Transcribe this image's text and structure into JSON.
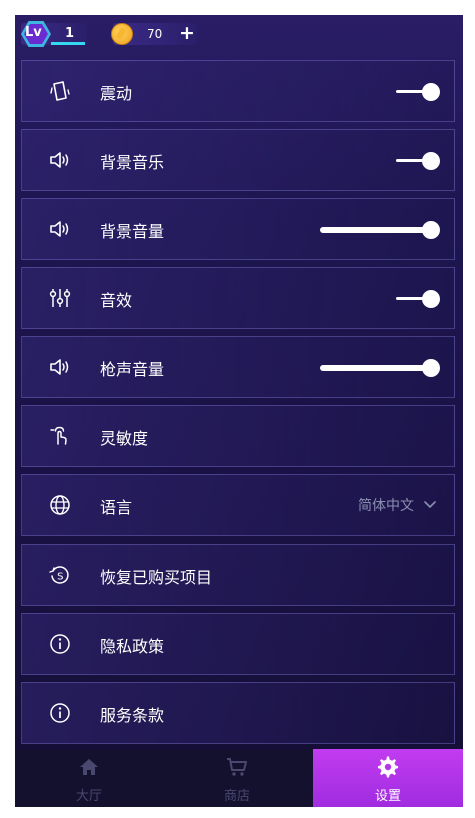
{
  "topbar": {
    "level_prefix": "Lv",
    "level": "1",
    "coins": "70",
    "add_symbol": "+"
  },
  "settings": [
    {
      "label": "震动",
      "icon": "vibration-icon",
      "control": "toggle",
      "on": true
    },
    {
      "label": "背景音乐",
      "icon": "speaker-icon",
      "control": "toggle",
      "on": true
    },
    {
      "label": "背景音量",
      "icon": "speaker-icon",
      "control": "slider",
      "level": 1.0
    },
    {
      "label": "音效",
      "icon": "equalizer-icon",
      "control": "toggle",
      "on": true
    },
    {
      "label": "枪声音量",
      "icon": "speaker-icon",
      "control": "slider",
      "level": 1.0
    },
    {
      "label": "灵敏度",
      "icon": "touch-icon",
      "control": "none"
    },
    {
      "label": "语言",
      "icon": "globe-icon",
      "control": "select",
      "value": "简体中文"
    },
    {
      "label": "恢复已购买项目",
      "icon": "restore-icon",
      "control": "none"
    },
    {
      "label": "隐私政策",
      "icon": "info-icon",
      "control": "none"
    },
    {
      "label": "服务条款",
      "icon": "info-icon",
      "control": "none"
    }
  ],
  "nav": [
    {
      "label": "大厅",
      "icon": "home-icon",
      "active": false
    },
    {
      "label": "商店",
      "icon": "cart-icon",
      "active": false
    },
    {
      "label": "设置",
      "icon": "gear-icon",
      "active": true
    }
  ],
  "colors": {
    "accent": "#b535ea",
    "panel_bg": "#1d1650",
    "muted_text": "#8a8fb0"
  }
}
